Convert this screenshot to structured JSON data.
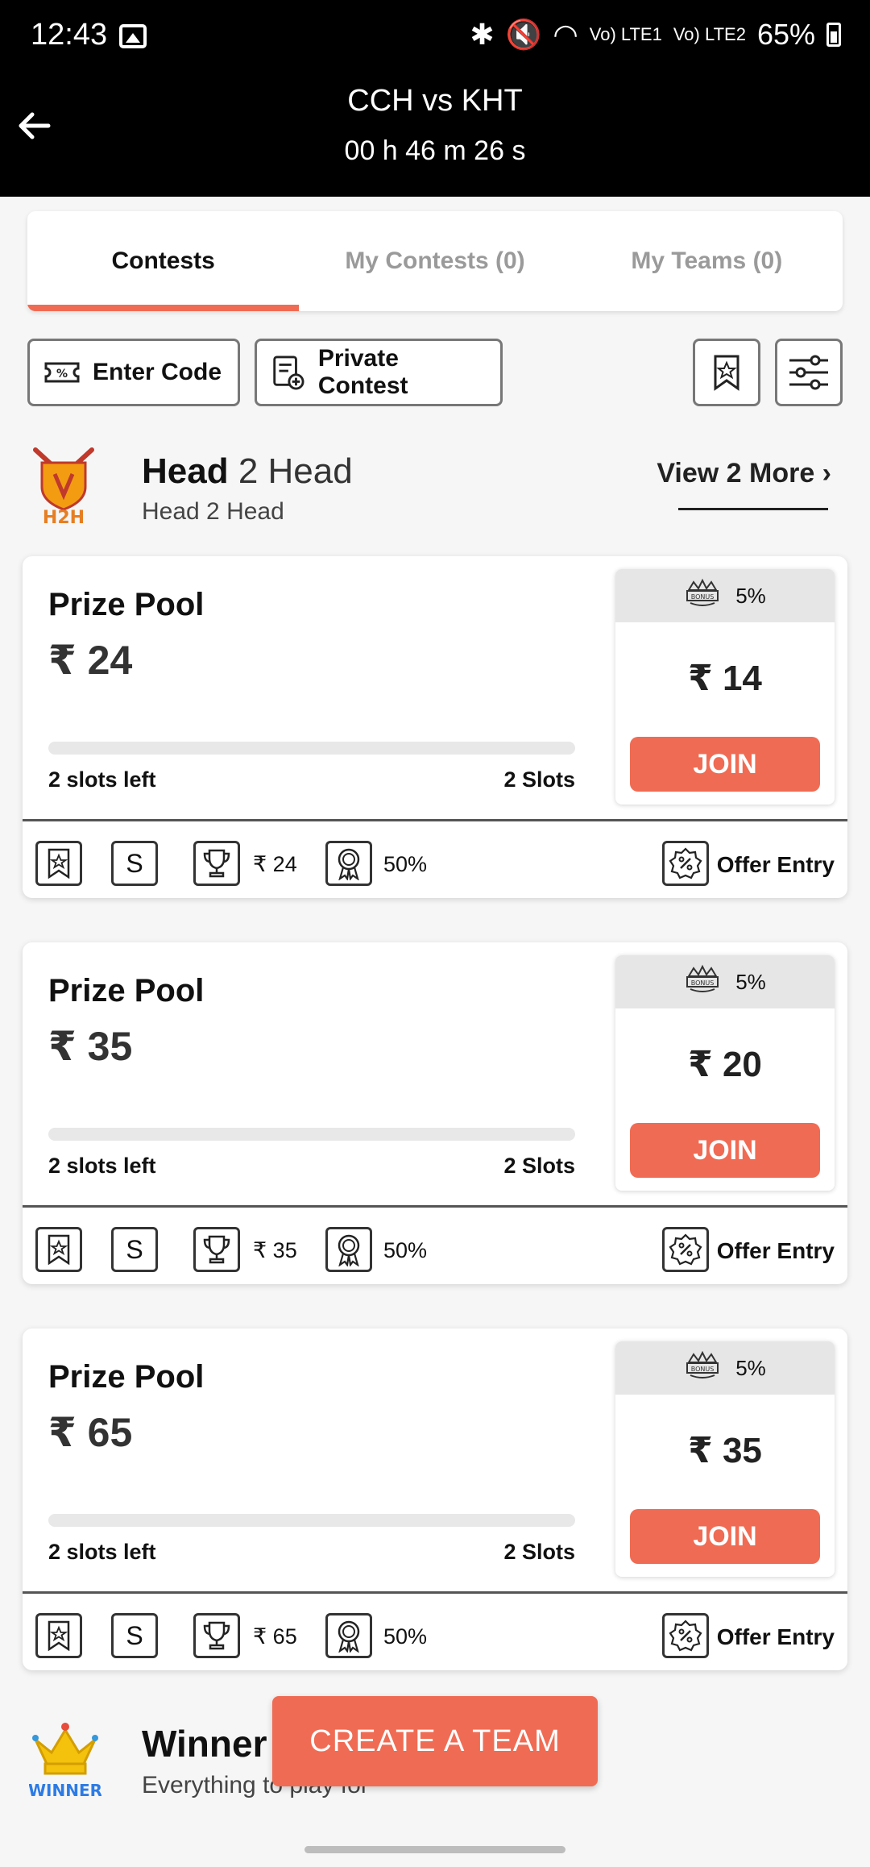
{
  "status_bar": {
    "time": "12:43",
    "battery": "65%",
    "signal_1": "Vo) LTE1",
    "signal_2": "Vo) LTE2"
  },
  "header": {
    "title": "CCH vs KHT",
    "timer": "00 h 46 m 26 s"
  },
  "tabs": [
    {
      "label": "Contests",
      "active": true
    },
    {
      "label": "My Contests (0)",
      "active": false
    },
    {
      "label": "My Teams (0)",
      "active": false
    }
  ],
  "actions": {
    "enter_code": "Enter Code",
    "private_contest": "Private Contest"
  },
  "section": {
    "title_bold": "Head",
    "title_rest": "2 Head",
    "subtitle": "Head 2 Head",
    "view_more": "View 2 More ›",
    "logo_text": "H2H"
  },
  "contests": [
    {
      "label": "Prize Pool",
      "prize": "₹ 24",
      "progress_filled": 0,
      "slots_left": "2 slots left",
      "slots_total": "2 Slots",
      "bonus": "5%",
      "fee": "₹ 14",
      "join": "JOIN",
      "foot_single": "S",
      "foot_prize": "₹ 24",
      "foot_win": "50%",
      "foot_offer": "Offer Entry"
    },
    {
      "label": "Prize Pool",
      "prize": "₹ 35",
      "progress_filled": 0,
      "slots_left": "2 slots left",
      "slots_total": "2 Slots",
      "bonus": "5%",
      "fee": "₹ 20",
      "join": "JOIN",
      "foot_single": "S",
      "foot_prize": "₹ 35",
      "foot_win": "50%",
      "foot_offer": "Offer Entry"
    },
    {
      "label": "Prize Pool",
      "prize": "₹ 65",
      "progress_filled": 0,
      "slots_left": "2 slots left",
      "slots_total": "2 Slots",
      "bonus": "5%",
      "fee": "₹ 35",
      "join": "JOIN",
      "foot_single": "S",
      "foot_prize": "₹ 65",
      "foot_win": "50%",
      "foot_offer": "Offer Entry"
    }
  ],
  "winner": {
    "title": "Winner",
    "subtitle": "Everything to play for",
    "logo_text": "WINNER"
  },
  "create_team": "CREATE A TEAM",
  "colors": {
    "accent": "#f06b53",
    "header_bg": "#000000",
    "page_bg": "#f6f6f6"
  }
}
